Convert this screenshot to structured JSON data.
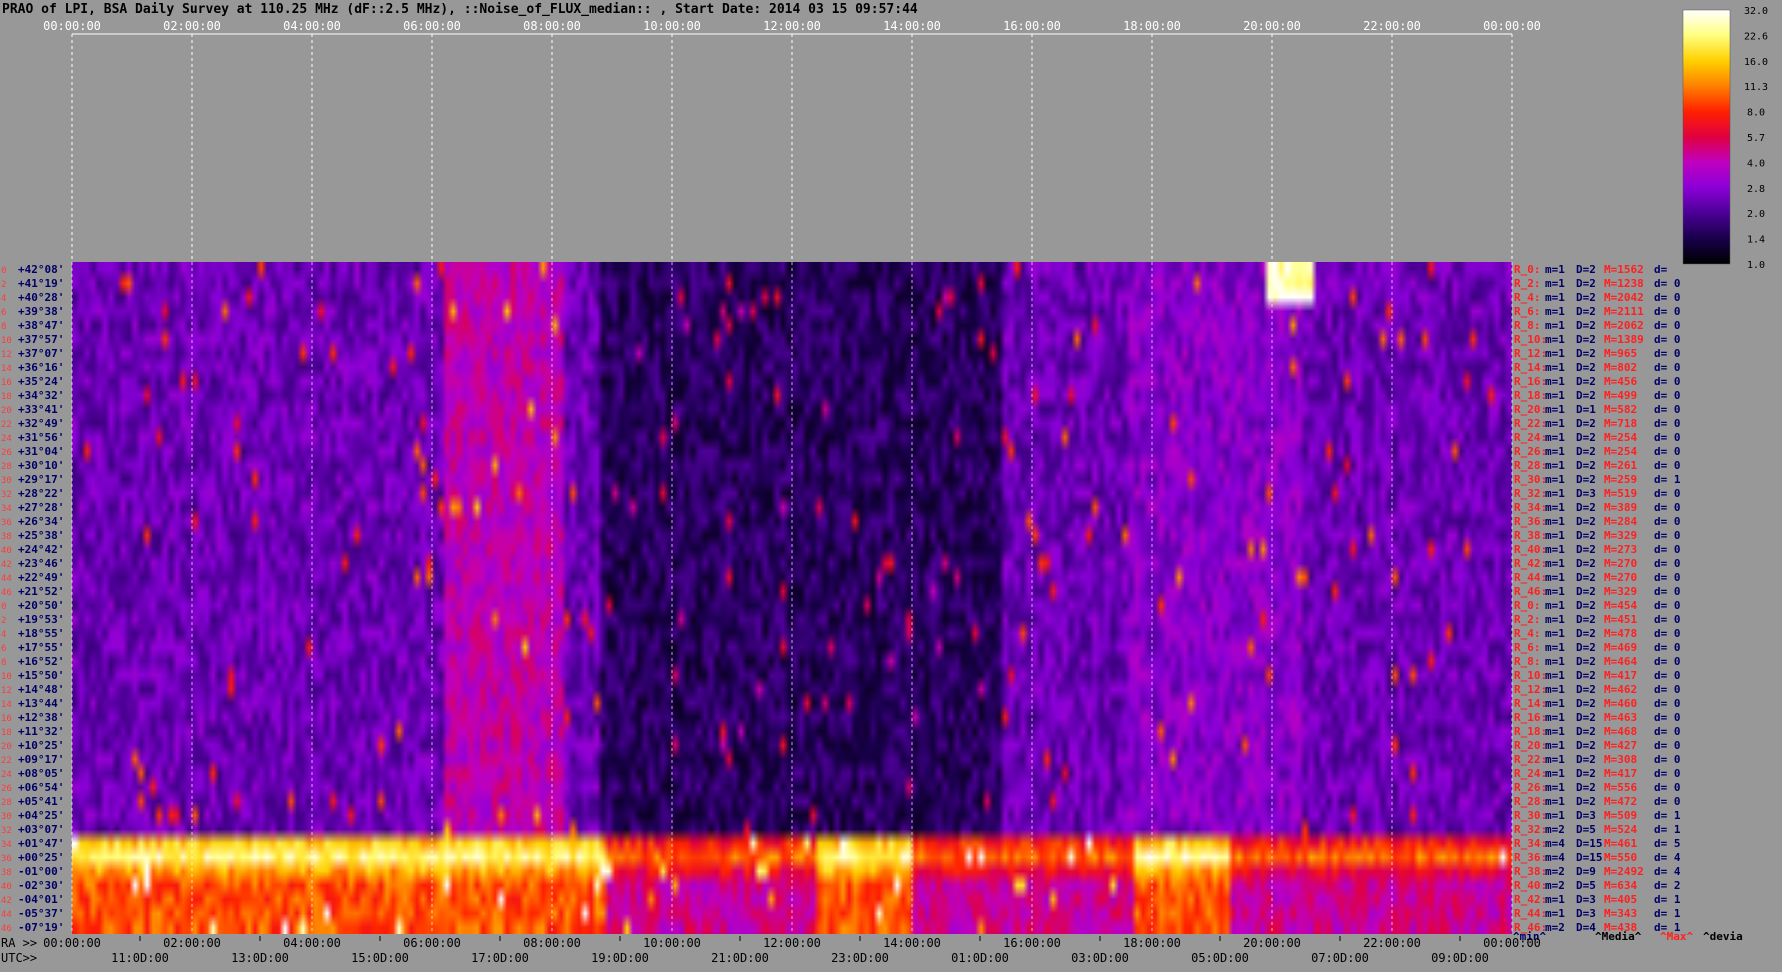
{
  "title": "PRAO of LPI, BSA Daily Survey at 110.25 MHz (dF::2.5 MHz), ::Noise_of_FLUX_median:: , Start Date: 2014 03 15 09:57:44",
  "colors": {
    "background": "#989898",
    "top_axis_text": "#ffffff",
    "bottom_axis_text": "#000000",
    "dec_label_text": "#000066",
    "row_index_text": "#ff3b3b",
    "beam_R_text": "#ff2020",
    "beam_mD_text": "#000066",
    "beam_M_text": "#ff2020",
    "legend_min": "#000066",
    "legend_media": "#000000",
    "legend_max": "#ff2020",
    "legend_devia": "#000000"
  },
  "colorbar": {
    "labels": [
      "32.0",
      "22.6",
      "16.0",
      "11.3",
      "8.0",
      "5.7",
      "4.0",
      "2.8",
      "2.0",
      "1.4",
      "1.0"
    ],
    "colormap": [
      "#000000",
      "#18004a",
      "#4b0094",
      "#8a00d8",
      "#c000c0",
      "#e00040",
      "#ff2000",
      "#ff8000",
      "#ffd000",
      "#ffff80",
      "#ffffff"
    ]
  },
  "top_time_axis": [
    "00:00:00",
    "02:00:00",
    "04:00:00",
    "06:00:00",
    "08:00:00",
    "10:00:00",
    "12:00:00",
    "14:00:00",
    "16:00:00",
    "18:00:00",
    "20:00:00",
    "22:00:00",
    "00:00:00"
  ],
  "bottom_axis": {
    "ra_prefix": "RA >>",
    "ra_labels": [
      "00:00:00",
      "02:00:00",
      "04:00:00",
      "06:00:00",
      "08:00:00",
      "10:00:00",
      "12:00:00",
      "14:00:00",
      "16:00:00",
      "18:00:00",
      "20:00:00",
      "22:00:00",
      "00:00:00"
    ],
    "utc_prefix": "UTC>>",
    "utc_labels": [
      "11:0D:00",
      "13:0D:00",
      "15:0D:00",
      "17:0D:00",
      "19:0D:00",
      "21:0D:00",
      "23:0D:00",
      "01:0D:00",
      "03:0D:00",
      "05:0D:00",
      "07:0D:00",
      "09:0D:00"
    ]
  },
  "chart_data": {
    "type": "heatmap",
    "title": "PRAO of LPI, BSA Daily Survey at 110.25 MHz (dF::2.5 MHz), ::Noise_of_FLUX_median:: , Start Date: 2014 03 15 09:57:44",
    "x_axis": "RA 00:00:00 – 24:00:00",
    "y_axis": "Declination (beam rows, +42°08' to -07°19')",
    "colorscale_range": [
      1.0,
      32.0
    ],
    "declinations": [
      "+42°08'",
      "+41°19'",
      "+40°28'",
      "+39°38'",
      "+38°47'",
      "+37°57'",
      "+37°07'",
      "+36°16'",
      "+35°24'",
      "+34°32'",
      "+33°41'",
      "+32°49'",
      "+31°56'",
      "+31°04'",
      "+30°10'",
      "+29°17'",
      "+28°22'",
      "+27°28'",
      "+26°34'",
      "+25°38'",
      "+24°42'",
      "+23°46'",
      "+22°49'",
      "+21°52'",
      "+20°50'",
      "+19°53'",
      "+18°55'",
      "+17°55'",
      "+16°52'",
      "+15°50'",
      "+14°48'",
      "+13°44'",
      "+12°38'",
      "+11°32'",
      "+10°25'",
      "+09°17'",
      "+08°05'",
      "+06°54'",
      "+05°41'",
      "+04°25'",
      "+03°07'",
      "+01°47'",
      "+00°25'",
      "-01°00'",
      "-02°30'",
      "-04°01'",
      "-05°37'",
      "-07°19'"
    ],
    "row_indices": [
      "0",
      "2",
      "4",
      "6",
      "8",
      "10",
      "12",
      "14",
      "16",
      "18",
      "20",
      "22",
      "24",
      "26",
      "28",
      "30",
      "32",
      "34",
      "36",
      "38",
      "40",
      "42",
      "44",
      "46",
      "0",
      "2",
      "4",
      "6",
      "8",
      "10",
      "12",
      "14",
      "16",
      "18",
      "20",
      "22",
      "24",
      "26",
      "28",
      "30",
      "32",
      "34",
      "36",
      "38",
      "40",
      "42",
      "44",
      "46"
    ],
    "beams": [
      {
        "r": "R_0:",
        "m": "m=1",
        "d": "D=2",
        "M": "M=1562",
        "dv": "d= "
      },
      {
        "r": "R_2:",
        "m": "m=1",
        "d": "D=2",
        "M": "M=1238",
        "dv": "d= 0"
      },
      {
        "r": "R_4:",
        "m": "m=1",
        "d": "D=2",
        "M": "M=2042",
        "dv": "d= 0"
      },
      {
        "r": "R_6:",
        "m": "m=1",
        "d": "D=2",
        "M": "M=2111",
        "dv": "d= 0"
      },
      {
        "r": "R_8:",
        "m": "m=1",
        "d": "D=2",
        "M": "M=2062",
        "dv": "d= 0"
      },
      {
        "r": "R_10:",
        "m": "m=1",
        "d": "D=2",
        "M": "M=1389",
        "dv": "d= 0"
      },
      {
        "r": "R_12:",
        "m": "m=1",
        "d": "D=2",
        "M": "M=965",
        "dv": "d= 0"
      },
      {
        "r": "R_14:",
        "m": "m=1",
        "d": "D=2",
        "M": "M=802",
        "dv": "d= 0"
      },
      {
        "r": "R_16:",
        "m": "m=1",
        "d": "D=2",
        "M": "M=456",
        "dv": "d= 0"
      },
      {
        "r": "R_18:",
        "m": "m=1",
        "d": "D=2",
        "M": "M=499",
        "dv": "d= 0"
      },
      {
        "r": "R_20:",
        "m": "m=1",
        "d": "D=1",
        "M": "M=582",
        "dv": "d= 0"
      },
      {
        "r": "R_22:",
        "m": "m=1",
        "d": "D=2",
        "M": "M=718",
        "dv": "d= 0"
      },
      {
        "r": "R_24:",
        "m": "m=1",
        "d": "D=2",
        "M": "M=254",
        "dv": "d= 0"
      },
      {
        "r": "R_26:",
        "m": "m=1",
        "d": "D=2",
        "M": "M=254",
        "dv": "d= 0"
      },
      {
        "r": "R_28:",
        "m": "m=1",
        "d": "D=2",
        "M": "M=261",
        "dv": "d= 0"
      },
      {
        "r": "R_30:",
        "m": "m=1",
        "d": "D=2",
        "M": "M=259",
        "dv": "d= 1"
      },
      {
        "r": "R_32:",
        "m": "m=1",
        "d": "D=3",
        "M": "M=519",
        "dv": "d= 0"
      },
      {
        "r": "R_34:",
        "m": "m=1",
        "d": "D=2",
        "M": "M=389",
        "dv": "d= 0"
      },
      {
        "r": "R_36:",
        "m": "m=1",
        "d": "D=2",
        "M": "M=284",
        "dv": "d= 0"
      },
      {
        "r": "R_38:",
        "m": "m=1",
        "d": "D=2",
        "M": "M=329",
        "dv": "d= 0"
      },
      {
        "r": "R_40:",
        "m": "m=1",
        "d": "D=2",
        "M": "M=273",
        "dv": "d= 0"
      },
      {
        "r": "R_42:",
        "m": "m=1",
        "d": "D=2",
        "M": "M=270",
        "dv": "d= 0"
      },
      {
        "r": "R_44:",
        "m": "m=1",
        "d": "D=2",
        "M": "M=270",
        "dv": "d= 0"
      },
      {
        "r": "R_46:",
        "m": "m=1",
        "d": "D=2",
        "M": "M=329",
        "dv": "d= 0"
      },
      {
        "r": "R_0:",
        "m": "m=1",
        "d": "D=2",
        "M": "M=454",
        "dv": "d= 0"
      },
      {
        "r": "R_2:",
        "m": "m=1",
        "d": "D=2",
        "M": "M=451",
        "dv": "d= 0"
      },
      {
        "r": "R_4:",
        "m": "m=1",
        "d": "D=2",
        "M": "M=478",
        "dv": "d= 0"
      },
      {
        "r": "R_6:",
        "m": "m=1",
        "d": "D=2",
        "M": "M=469",
        "dv": "d= 0"
      },
      {
        "r": "R_8:",
        "m": "m=1",
        "d": "D=2",
        "M": "M=464",
        "dv": "d= 0"
      },
      {
        "r": "R_10:",
        "m": "m=1",
        "d": "D=2",
        "M": "M=417",
        "dv": "d= 0"
      },
      {
        "r": "R_12:",
        "m": "m=1",
        "d": "D=2",
        "M": "M=462",
        "dv": "d= 0"
      },
      {
        "r": "R_14:",
        "m": "m=1",
        "d": "D=2",
        "M": "M=460",
        "dv": "d= 0"
      },
      {
        "r": "R_16:",
        "m": "m=1",
        "d": "D=2",
        "M": "M=463",
        "dv": "d= 0"
      },
      {
        "r": "R_18:",
        "m": "m=1",
        "d": "D=2",
        "M": "M=468",
        "dv": "d= 0"
      },
      {
        "r": "R_20:",
        "m": "m=1",
        "d": "D=2",
        "M": "M=427",
        "dv": "d= 0"
      },
      {
        "r": "R_22:",
        "m": "m=1",
        "d": "D=2",
        "M": "M=308",
        "dv": "d= 0"
      },
      {
        "r": "R_24:",
        "m": "m=1",
        "d": "D=2",
        "M": "M=417",
        "dv": "d= 0"
      },
      {
        "r": "R_26:",
        "m": "m=1",
        "d": "D=2",
        "M": "M=556",
        "dv": "d= 0"
      },
      {
        "r": "R_28:",
        "m": "m=1",
        "d": "D=2",
        "M": "M=472",
        "dv": "d= 0"
      },
      {
        "r": "R_30:",
        "m": "m=1",
        "d": "D=3",
        "M": "M=509",
        "dv": "d= 1"
      },
      {
        "r": "R_32:",
        "m": "m=2",
        "d": "D=5",
        "M": "M=524",
        "dv": "d= 1"
      },
      {
        "r": "R_34:",
        "m": "m=4",
        "d": "D=15",
        "M": "M=461",
        "dv": "d= 5"
      },
      {
        "r": "R_36:",
        "m": "m=4",
        "d": "D=15",
        "M": "M=550",
        "dv": "d= 4"
      },
      {
        "r": "R_38:",
        "m": "m=2",
        "d": "D=9",
        "M": "M=2492",
        "dv": "d= 4"
      },
      {
        "r": "R_40:",
        "m": "m=2",
        "d": "D=5",
        "M": "M=634",
        "dv": "d= 2"
      },
      {
        "r": "R_42:",
        "m": "m=1",
        "d": "D=3",
        "M": "M=405",
        "dv": "d= 1"
      },
      {
        "r": "R_44:",
        "m": "m=1",
        "d": "D=3",
        "M": "M=343",
        "dv": "d= 1"
      },
      {
        "r": "R_46:",
        "m": "m=2",
        "d": "D=4",
        "M": "M=438",
        "dv": "d= 1"
      }
    ],
    "legend": {
      "min": "^min^",
      "media": "^Media^",
      "max": "^Max^",
      "devia": "^devia"
    }
  }
}
